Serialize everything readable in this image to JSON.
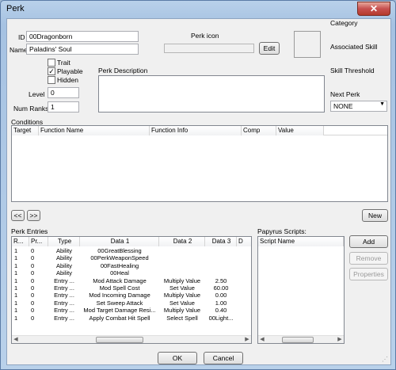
{
  "window": {
    "title": "Perk",
    "close": "✕"
  },
  "fields": {
    "id_label": "ID",
    "id_value": "00Dragonborn",
    "name_label": "Name",
    "name_value": "Paladins' Soul",
    "level_label": "Level",
    "level_value": "0",
    "numranks_label": "Num Ranks",
    "numranks_value": "1"
  },
  "flags": [
    {
      "label": "Trait",
      "checked": false
    },
    {
      "label": "Playable",
      "checked": true
    },
    {
      "label": "Hidden",
      "checked": false
    }
  ],
  "icon": {
    "label": "Perk icon",
    "value": "",
    "edit": "Edit"
  },
  "description": {
    "label": "Perk Description",
    "value": ""
  },
  "right_panel": {
    "category": "Category",
    "associated_skill": "Associated Skill",
    "skill_threshold": "Skill Threshold",
    "next_perk_label": "Next Perk",
    "next_perk_value": "NONE"
  },
  "conditions": {
    "label": "Conditions",
    "columns": [
      "Target",
      "Function Name",
      "Function Info",
      "Comp",
      "Value"
    ],
    "prev": "<<",
    "next": ">>",
    "new": "New"
  },
  "perk_entries": {
    "label": "Perk Entries",
    "columns": [
      "R...",
      "Pr...",
      "Type",
      "Data 1",
      "Data 2",
      "Data 3",
      "D"
    ],
    "rows": [
      [
        "1",
        "0",
        "Ability",
        "00GreatBlessing",
        "",
        ""
      ],
      [
        "1",
        "0",
        "Ability",
        "00PerkWeaponSpeed",
        "",
        ""
      ],
      [
        "1",
        "0",
        "Ability",
        "00FastHealing",
        "",
        ""
      ],
      [
        "1",
        "0",
        "Ability",
        "00Heal",
        "",
        ""
      ],
      [
        "1",
        "0",
        "Entry ...",
        "Mod Attack Damage",
        "Multiply Value",
        "2.50"
      ],
      [
        "1",
        "0",
        "Entry ...",
        "Mod Spell Cost",
        "Set Value",
        "60.00"
      ],
      [
        "1",
        "0",
        "Entry ...",
        "Mod Incoming Damage",
        "Multiply Value",
        "0.00"
      ],
      [
        "1",
        "0",
        "Entry ...",
        "Set Sweep Attack",
        "Set Value",
        "1.00"
      ],
      [
        "1",
        "0",
        "Entry ...",
        "Mod Target Damage Resi...",
        "Multiply Value",
        "0.40"
      ],
      [
        "1",
        "0",
        "Entry ...",
        "Apply Combat Hit Spell",
        "Select Spell",
        "00Light..."
      ]
    ]
  },
  "papyrus": {
    "label": "Papyrus Scripts:",
    "column": "Script Name",
    "add": "Add",
    "remove": "Remove",
    "properties": "Properties"
  },
  "footer": {
    "ok": "OK",
    "cancel": "Cancel"
  }
}
